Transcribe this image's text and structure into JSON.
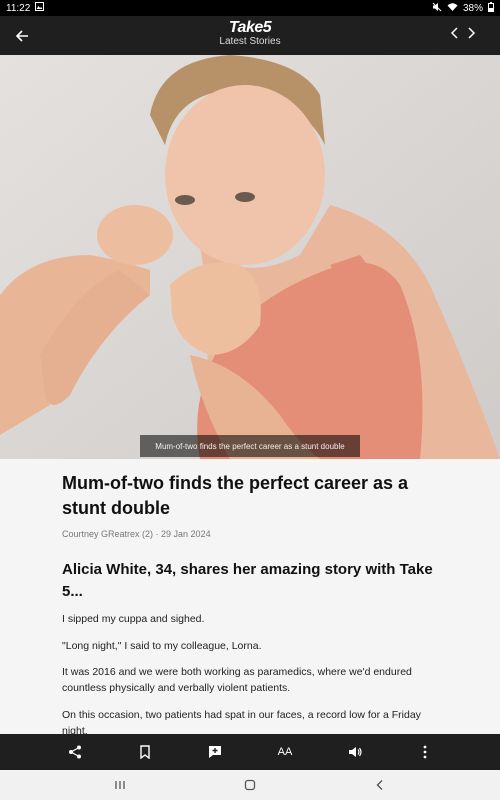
{
  "status": {
    "time": "11:22",
    "battery": "38%"
  },
  "header": {
    "brand": "Take5",
    "subtitle": "Latest Stories"
  },
  "hero": {
    "caption": "Mum-of-two finds the perfect career as a stunt double"
  },
  "article": {
    "title": "Mum-of-two finds the perfect career as a stunt double",
    "byline": "Courtney GReatrex (2) · 29 Jan 2024",
    "standfirst": "Alicia White, 34, shares her amazing story with Take 5...",
    "paragraphs": [
      "I sipped my cuppa and sighed.",
      "\"Long night,\" I said to my colleague, Lorna.",
      "It was 2016 and we were both working as paramedics, where we'd endured countless physically and verbally violent patients.",
      "On this occasion, two patients had spat in our faces, a record low for a Friday night."
    ]
  },
  "toolbar": {
    "text_size_label": "AA",
    "icons": [
      "share-icon",
      "bookmark-icon",
      "comment-add-icon",
      "text-size-icon",
      "speaker-icon",
      "more-icon"
    ]
  }
}
